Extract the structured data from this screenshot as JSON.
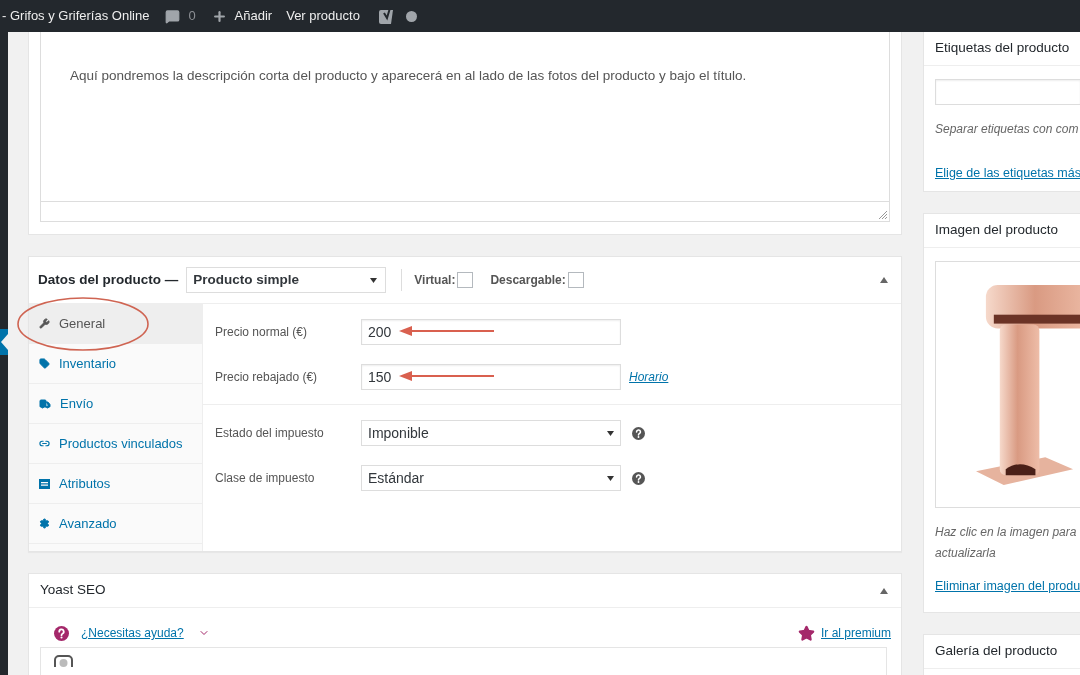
{
  "admin_bar": {
    "site_title": "- Grifos y Griferías Online",
    "comments": "0",
    "new_label": "Añadir",
    "view_label": "Ver producto"
  },
  "short_description": {
    "text": "Aquí pondremos la descripción corta del producto y aparecerá en al lado de las fotos del producto y bajo el título."
  },
  "product_data": {
    "title": "Datos del producto —",
    "type": "Producto simple",
    "options": [
      {
        "label": "Virtual:",
        "checked": false
      },
      {
        "label": "Descargable:",
        "checked": false
      }
    ],
    "tabs": [
      {
        "label": "General",
        "selected": true,
        "circled": true
      },
      {
        "label": "Inventario",
        "selected": false,
        "circled": false
      },
      {
        "label": "Envío",
        "selected": false,
        "circled": false
      },
      {
        "label": "Productos vinculados",
        "selected": false,
        "circled": false
      },
      {
        "label": "Atributos",
        "selected": false,
        "circled": false
      },
      {
        "label": "Avanzado",
        "selected": false,
        "circled": false
      }
    ],
    "groups": [
      {
        "fields": [
          {
            "kind": "input",
            "label": "Precio normal (€)",
            "value": "200",
            "arrowed": true
          },
          {
            "kind": "input",
            "label": "Precio rebajado (€)",
            "value": "150",
            "arrowed": true,
            "link": "Horario"
          }
        ]
      },
      {
        "fields": [
          {
            "kind": "select",
            "label": "Estado del impuesto",
            "value": "Imponible",
            "help": true
          },
          {
            "kind": "select",
            "label": "Clase de impuesto",
            "value": "Estándar",
            "help": true
          }
        ]
      }
    ]
  },
  "yoast": {
    "title": "Yoast SEO",
    "help_link": "¿Necesitas ayuda?",
    "premium_link": "Ir al premium"
  },
  "sidebar": {
    "tags": {
      "title": "Etiquetas del producto",
      "hint": "Separar etiquetas con com",
      "link": "Elige de las etiquetas más"
    },
    "image": {
      "title": "Imagen del producto",
      "hint_lines": [
        "Haz clic en la imagen para",
        "actualizarla"
      ],
      "link": "Eliminar imagen del produ"
    },
    "gallery": {
      "title": "Galería del producto"
    }
  }
}
